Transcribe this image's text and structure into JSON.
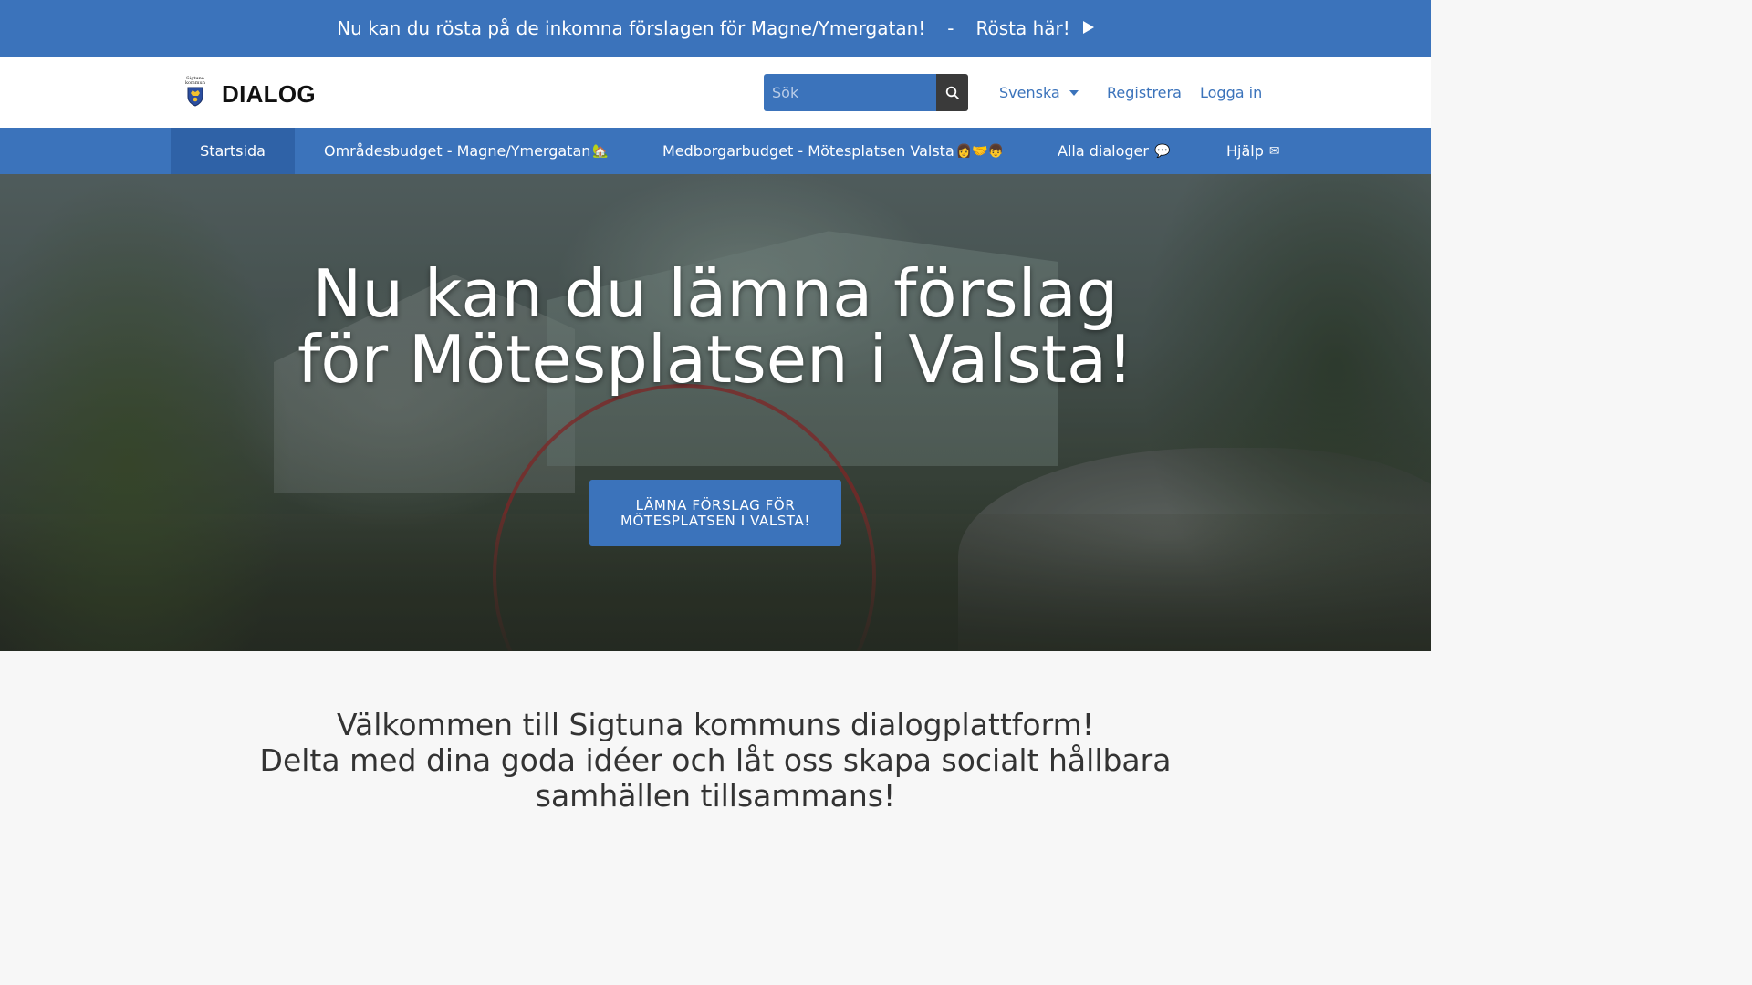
{
  "announcement": {
    "text": "Nu kan du rösta på de inkomna förslagen för Magne/Ymergatan!",
    "separator": "-",
    "link_label": "Rösta här!"
  },
  "header": {
    "crest_text_line1": "Sigtuna",
    "crest_text_line2": "kommun",
    "brand": "DIALOG",
    "search_placeholder": "Sök",
    "language": "Svenska",
    "register": "Registrera",
    "login": "Logga in"
  },
  "nav": {
    "items": [
      {
        "label": "Startsida",
        "emoji": ""
      },
      {
        "label": "Områdesbudget - Magne/Ymergatan",
        "emoji": "🏡"
      },
      {
        "label": "Medborgarbudget - Mötesplatsen Valsta",
        "emoji": "👩🤝👦"
      },
      {
        "label": "Alla dialoger",
        "emoji": "💬"
      },
      {
        "label": "Hjälp",
        "emoji": "✉"
      }
    ]
  },
  "hero": {
    "title_line1": "Nu kan du lämna förslag",
    "title_line2": "för Mötesplatsen i Valsta!",
    "cta": "Lämna förslag för Mötesplatsen i Valsta!"
  },
  "welcome": {
    "line1": "Välkommen till Sigtuna kommuns dialogplattform!",
    "line2": "Delta med dina goda idéer och låt oss skapa socialt hållbara",
    "line3": "samhällen tillsammans!"
  },
  "colors": {
    "primary": "#3b73bb",
    "nav_active": "#2f62a7",
    "search_button": "#3a3a3a"
  }
}
